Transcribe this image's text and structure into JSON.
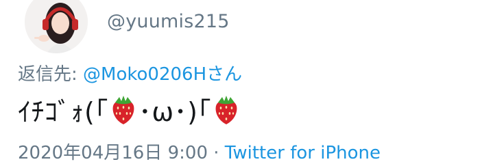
{
  "tweet": {
    "author": {
      "handle": "@yuumis215",
      "avatar": "avatar-girl-with-red-headphones"
    },
    "reply": {
      "prefix": "返信先: ",
      "mention": "@Moko0206Hさん"
    },
    "text": {
      "part1": "ｲﾁｺﾞｫ(｢",
      "emoji1": "strawberry-emoji",
      "part2": "･ω･)｢",
      "emoji2": "strawberry-emoji"
    },
    "meta": {
      "timestamp": "2020年04月16日 9:00",
      "separator": " · ",
      "source": "Twitter for iPhone"
    }
  },
  "colors": {
    "muted": "#657786",
    "link": "#1b95e0",
    "text": "#14171a",
    "strawberry_red": "#d8232a",
    "leaf_green": "#3fa535"
  }
}
